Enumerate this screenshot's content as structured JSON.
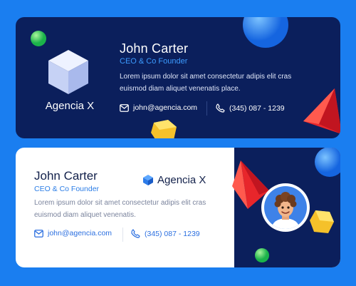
{
  "top_card": {
    "brand_name": "Agencia X",
    "person_name": "John Carter",
    "role": "CEO & Co Founder",
    "description": "Lorem ipsum dolor sit amet consectetur adipis elit cras euismod diam aliquet venenatis place.",
    "email": "john@agencia.com",
    "phone": "(345) 087 - 1239"
  },
  "bottom_card": {
    "person_name": "John Carter",
    "role": "CEO & Co Founder",
    "brand_name": "Agencia X",
    "description": "Lorem ipsum dolor sit amet consectetur adipis elit cras euismod diam aliquet venenatis.",
    "email": "john@agencia.com",
    "phone": "(345) 087 - 1239"
  },
  "colors": {
    "background": "#1a7ef0",
    "card_dark": "#0b1f5c",
    "accent_blue": "#3c9bff",
    "link_blue": "#2b6fe0"
  },
  "icons": [
    "cube-logo-icon",
    "mail-icon",
    "phone-icon",
    "avatar-image"
  ]
}
